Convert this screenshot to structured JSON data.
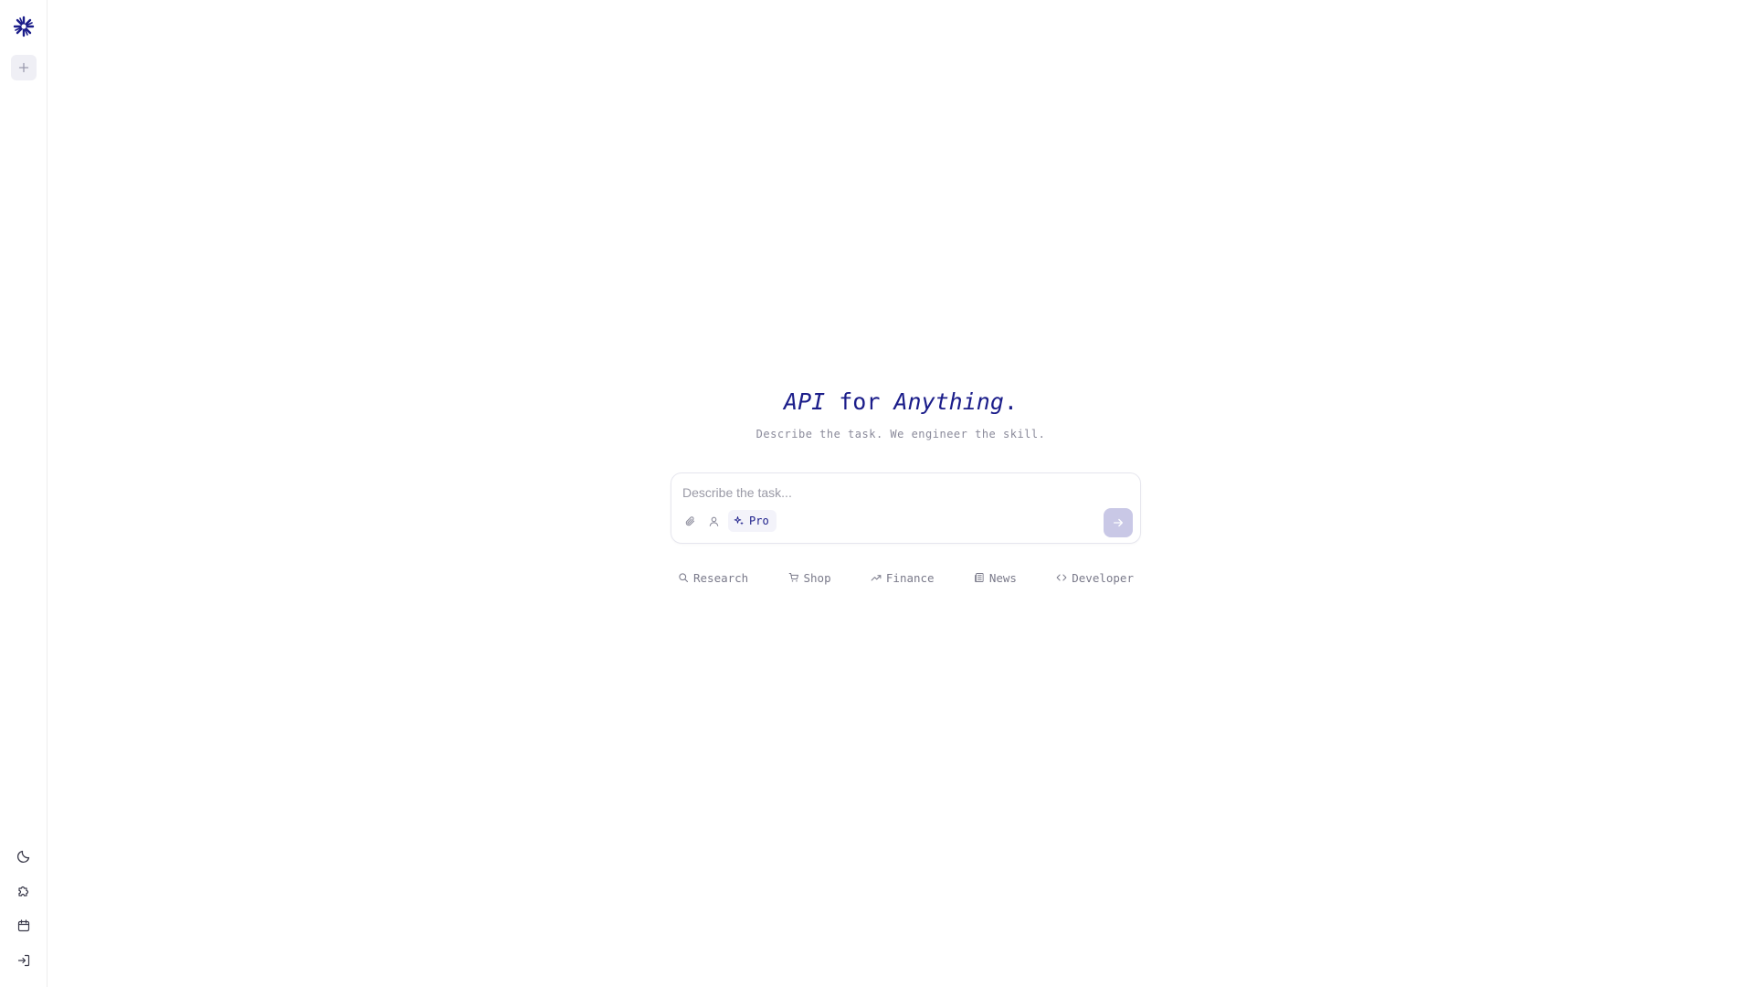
{
  "app": {
    "headline": {
      "part1": "API",
      "part2": " for ",
      "part3": "Anything",
      "part4": "."
    },
    "subtitle": "Describe the task. We engineer the skill."
  },
  "composer": {
    "placeholder": "Describe the task...",
    "pro_label": "Pro"
  },
  "suggestions": [
    {
      "label": "Research",
      "icon": "search-icon"
    },
    {
      "label": "Shop",
      "icon": "cart-icon"
    },
    {
      "label": "Finance",
      "icon": "trending-up-icon"
    },
    {
      "label": "News",
      "icon": "newspaper-icon"
    },
    {
      "label": "Developer",
      "icon": "code-icon"
    }
  ],
  "sidebar": {
    "top_icons": [
      "logo-icon",
      "plus-icon"
    ],
    "bottom_icons": [
      "moon-icon",
      "puzzle-icon",
      "calendar-icon",
      "login-icon"
    ]
  },
  "colors": {
    "brand": "#1b1d8a",
    "muted": "#7a7a8a",
    "send_button": "#c9c8e6"
  }
}
